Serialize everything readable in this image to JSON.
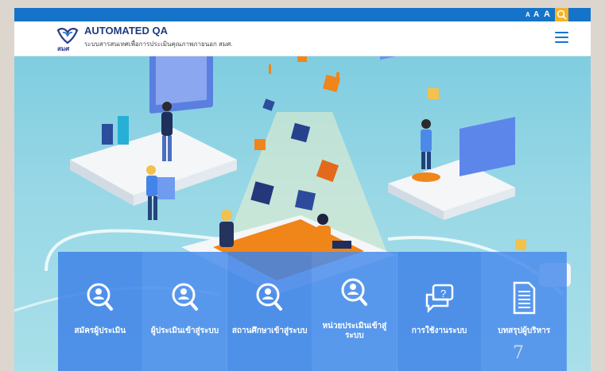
{
  "utility_bar": {
    "font_sizes": [
      "A",
      "A",
      "A"
    ],
    "search_icon": "search-icon"
  },
  "header": {
    "logo_text": "สมศ",
    "title": "AUTOMATED QA",
    "subtitle": "ระบบสารสนเทศเพื่อการประเมินคุณภาพภายนอก สมศ.",
    "menu_icon": "hamburger-icon"
  },
  "tiles": [
    {
      "label": "สมัครผู้ประเมิน",
      "icon": "search-user-icon"
    },
    {
      "label": "ผู้ประเมินเข้าสู่ระบบ",
      "icon": "search-user-icon"
    },
    {
      "label": "สถานศึกษาเข้าสู่ระบบ",
      "icon": "search-user-icon"
    },
    {
      "label": "หน่วยประเมินเข้าสู่ระบบ",
      "icon": "search-user-icon"
    },
    {
      "label": "การใช้งานระบบ",
      "icon": "chat-question-icon"
    },
    {
      "label": "บทสรุปผู้บริหาร",
      "icon": "document-icon"
    }
  ],
  "page_number": "7",
  "colors": {
    "utility_bar": "#1574c9",
    "accent_search": "#f5b324",
    "tile_blue": "#4084e8",
    "hero_sky": "#8fd0df"
  }
}
